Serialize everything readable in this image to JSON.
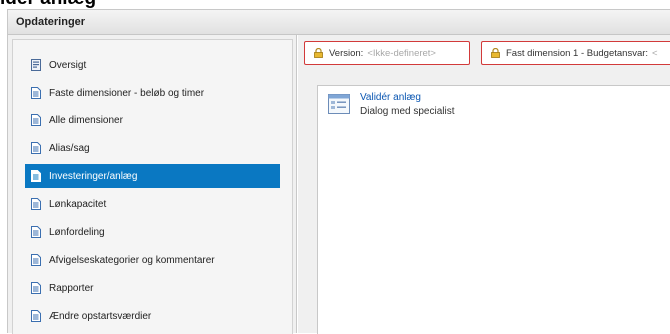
{
  "page_header_fragment": "ider anlæg",
  "window": {
    "title": "Opdateringer"
  },
  "sidebar": {
    "items": [
      {
        "label": "Oversigt",
        "icon": "overview-icon",
        "active": false
      },
      {
        "label": "Faste dimensioner - beløb og timer",
        "icon": "document-icon",
        "active": false
      },
      {
        "label": "Alle dimensioner",
        "icon": "document-icon",
        "active": false
      },
      {
        "label": "Alias/sag",
        "icon": "document-icon",
        "active": false
      },
      {
        "label": "Investeringer/anlæg",
        "icon": "document-icon",
        "active": true
      },
      {
        "label": "Lønkapacitet",
        "icon": "document-icon",
        "active": false
      },
      {
        "label": "Lønfordeling",
        "icon": "document-icon",
        "active": false
      },
      {
        "label": "Afvigelseskategorier og kommentarer",
        "icon": "document-icon",
        "active": false
      },
      {
        "label": "Rapporter",
        "icon": "document-icon",
        "active": false
      },
      {
        "label": "Ændre opstartsværdier",
        "icon": "document-icon",
        "active": false
      }
    ]
  },
  "filters": {
    "version": {
      "label": "Version:",
      "value": "<Ikke-defineret>",
      "icon": "lock-icon"
    },
    "fixed_dimension": {
      "label": "Fast dimension 1 - Budgetansvar:",
      "value": "<",
      "icon": "lock-icon"
    }
  },
  "main": {
    "entries": [
      {
        "title": "Validér anlæg",
        "subtitle": "Dialog med specialist",
        "icon": "dialog-window-icon"
      }
    ]
  },
  "colors": {
    "accent": "#0a78c2",
    "alert_border": "#d23a3a",
    "link": "#0a56b2"
  }
}
